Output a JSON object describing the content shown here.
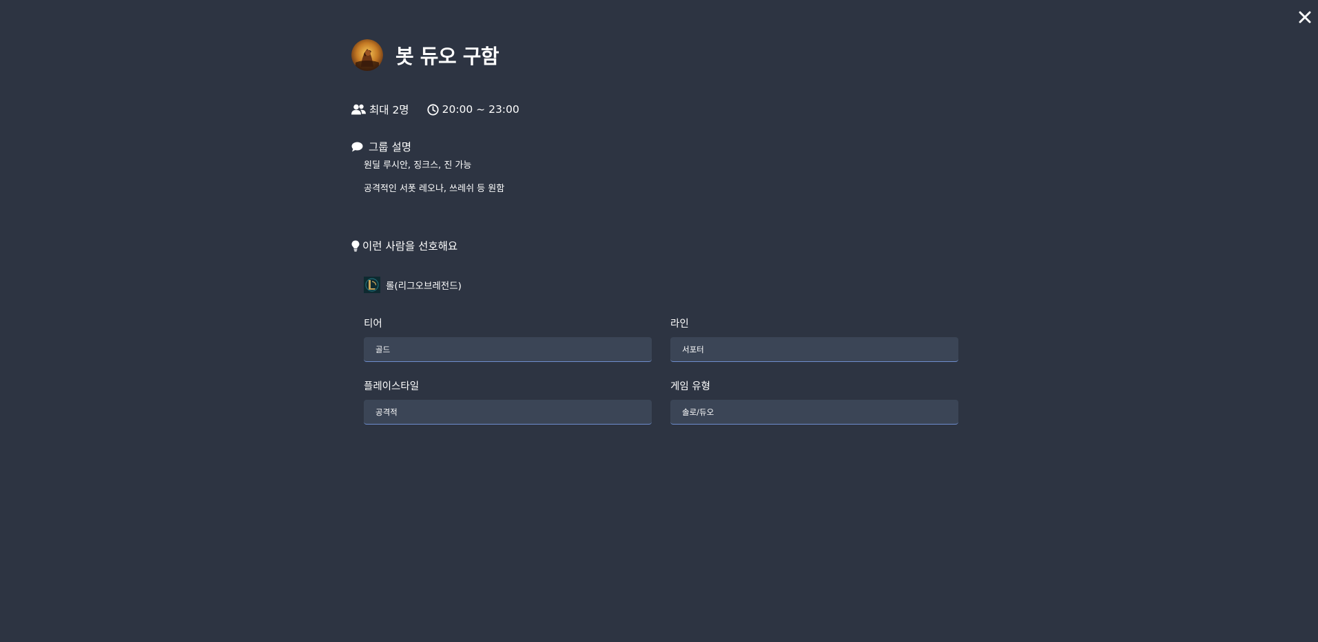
{
  "modal": {
    "close_icon": "close-icon",
    "title": "봇 듀오 구함",
    "avatar_icon": "champion-portrait"
  },
  "meta": {
    "capacity": "최대 2명",
    "time": "20:00 ~ 23:00",
    "capacity_icon": "users-icon",
    "time_icon": "clock-icon"
  },
  "description": {
    "title": "그룹 설명",
    "icon": "comment-icon",
    "lines": [
      "원딜 루시안, 징크스, 진 가능",
      "공격적인 서폿 레오나, 쓰레쉬 등 원함"
    ]
  },
  "preferences": {
    "title": "이런 사람을 선호해요",
    "icon": "lightbulb-icon",
    "game": {
      "label": "롤(리그오브레전드)",
      "icon": "league-of-legends-logo"
    },
    "fields": [
      {
        "label": "티어",
        "value": "골드"
      },
      {
        "label": "라인",
        "value": "서포터"
      },
      {
        "label": "플레이스타일",
        "value": "공격적"
      },
      {
        "label": "게임 유형",
        "value": "솔로/듀오"
      }
    ]
  },
  "colors": {
    "background": "#2d3442",
    "field_background": "#3b4556",
    "field_underline": "#6f8fd0",
    "text": "#ffffff"
  }
}
